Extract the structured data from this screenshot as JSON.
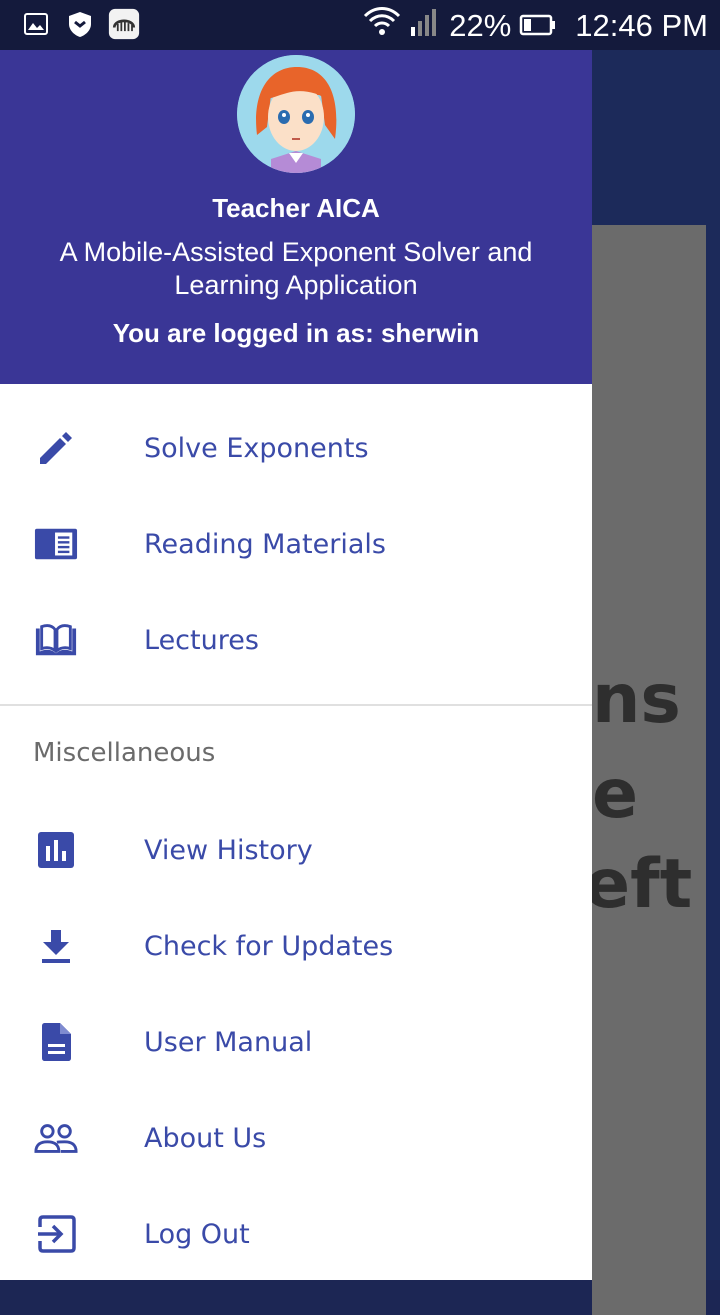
{
  "status_bar": {
    "wifi_icon": "wifi-icon",
    "signal_icon": "signal-icon",
    "battery_percent": "22%",
    "battery_icon": "battery-icon",
    "time": "12:46 PM",
    "notification_icons": [
      "image-icon",
      "shield-icon",
      "audio-app-icon"
    ]
  },
  "background_app": {
    "text_fragments": [
      "ns",
      "e",
      "eft"
    ]
  },
  "drawer": {
    "header": {
      "avatar_icon": "avatar",
      "title": "Teacher AICA",
      "subtitle": "A Mobile-Assisted Exponent Solver and Learning Application",
      "logged_in": "You are logged in as: sherwin"
    },
    "items": [
      {
        "label": "Solve Exponents",
        "icon": "pencil-icon"
      },
      {
        "label": "Reading Materials",
        "icon": "document-icon"
      },
      {
        "label": "Lectures",
        "icon": "book-icon"
      }
    ],
    "section": "Miscellaneous",
    "misc_items": [
      {
        "label": "View History",
        "icon": "chart-icon"
      },
      {
        "label": "Check for Updates",
        "icon": "download-icon"
      },
      {
        "label": "User Manual",
        "icon": "file-icon"
      },
      {
        "label": "About Us",
        "icon": "people-icon"
      },
      {
        "label": "Log Out",
        "icon": "logout-icon"
      }
    ]
  },
  "colors": {
    "header_bg": "#3a3696",
    "accent": "#3a4aa8",
    "status_bar_bg": "#141a3c"
  }
}
